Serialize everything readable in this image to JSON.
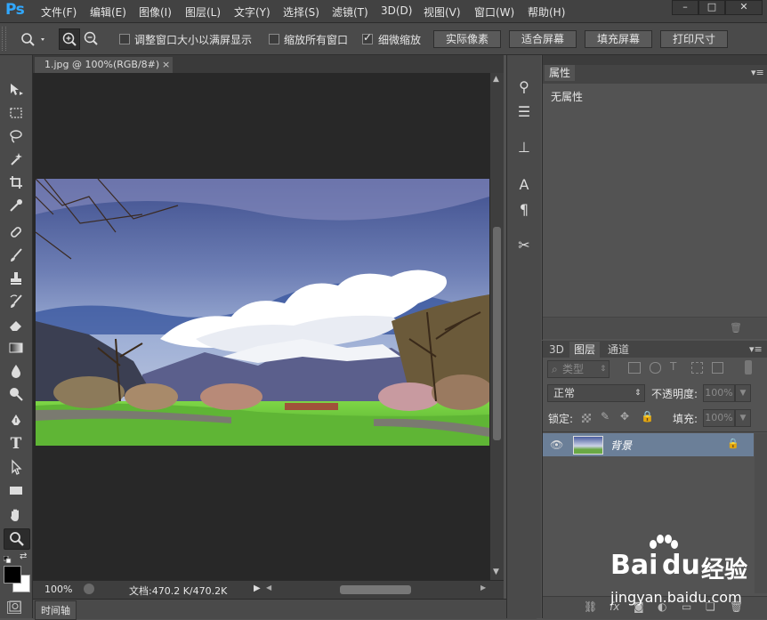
{
  "app": {
    "logo": "Ps"
  },
  "menu": [
    "文件(F)",
    "编辑(E)",
    "图像(I)",
    "图层(L)",
    "文字(Y)",
    "选择(S)",
    "滤镜(T)",
    "3D(D)",
    "视图(V)",
    "窗口(W)",
    "帮助(H)"
  ],
  "window_buttons": {
    "minimize": "–",
    "maximize": "□",
    "close": "✕"
  },
  "options": {
    "checkboxes": [
      {
        "label": "调整窗口大小以满屏显示",
        "checked": false
      },
      {
        "label": "缩放所有窗口",
        "checked": false
      },
      {
        "label": "细微缩放",
        "checked": true
      }
    ],
    "buttons": [
      "实际像素",
      "适合屏幕",
      "填充屏幕",
      "打印尺寸"
    ]
  },
  "document": {
    "tab_title": "1.jpg @ 100%(RGB/8#)",
    "tab_close": "×",
    "zoom": "100%",
    "doc_info": "文档:470.2 K/470.2K"
  },
  "timeline": {
    "label": "时间轴"
  },
  "properties": {
    "tab": "属性",
    "content": "无属性"
  },
  "layers_panel": {
    "tabs": [
      "3D",
      "图层",
      "通道"
    ],
    "active_tab": "图层",
    "filter_kind": "类型",
    "blend_mode": "正常",
    "opacity_label": "不透明度:",
    "opacity_value": "100%",
    "lock_label": "锁定:",
    "fill_label": "填充:",
    "fill_value": "100%",
    "layer_name": "背景"
  },
  "watermark": {
    "brand": "Bai",
    "brand2": "du",
    "suffix": "经验",
    "url": "jingyan.baidu.com"
  },
  "colors": {
    "accent": "#31a8ff",
    "layer_selected": "#6b7f98",
    "canvas": "#282828"
  }
}
